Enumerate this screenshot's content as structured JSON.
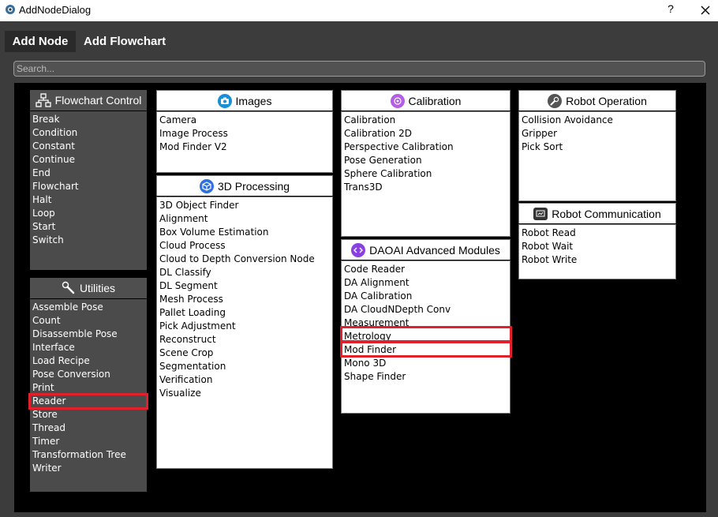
{
  "window": {
    "title": "AddNodeDialog",
    "help": "?"
  },
  "tabs": [
    {
      "label": "Add Node"
    },
    {
      "label": "Add Flowchart"
    }
  ],
  "search": {
    "placeholder": "Search..."
  },
  "colors": {
    "highlight": "#e0202a",
    "images_icon": "#1a8fd6",
    "calibration_icon": "#b45ee8",
    "processing_icon": "#2f6fe0",
    "daoai_icon": "#8a3fe0"
  },
  "panels": {
    "flowchart_control": {
      "title": "Flowchart Control",
      "icon": "flowchart-icon",
      "items": [
        "Break",
        "Condition",
        "Constant",
        "Continue",
        "End",
        "Flowchart",
        "Halt",
        "Loop",
        "Start",
        "Switch"
      ]
    },
    "utilities": {
      "title": "Utilities",
      "icon": "wrench-icon",
      "items": [
        "Assemble Pose",
        "Count",
        "Disassemble Pose",
        "Interface",
        "Load Recipe",
        "Pose Conversion",
        "Print",
        "Reader",
        "Store",
        "Thread",
        "Timer",
        "Transformation Tree",
        "Writer"
      ]
    },
    "images": {
      "title": "Images",
      "icon": "camera-icon",
      "items": [
        "Camera",
        "Image Process",
        "Mod Finder V2"
      ]
    },
    "processing_3d": {
      "title": "3D Processing",
      "icon": "cube-icon",
      "items": [
        "3D Object Finder",
        "Alignment",
        "Box Volume Estimation",
        "Cloud Process",
        "Cloud to Depth Conversion Node",
        "DL Classify",
        "DL Segment",
        "Mesh Process",
        "Pallet Loading",
        "Pick Adjustment",
        "Reconstruct",
        "Scene Crop",
        "Segmentation",
        "Verification",
        "Visualize"
      ]
    },
    "calibration": {
      "title": "Calibration",
      "icon": "target-icon",
      "items": [
        "Calibration",
        "Calibration 2D",
        "Perspective Calibration",
        "Pose Generation",
        "Sphere Calibration",
        "Trans3D"
      ]
    },
    "daoai": {
      "title": "DAOAI Advanced Modules",
      "icon": "code-icon",
      "items": [
        "Code Reader",
        "DA Alignment",
        "DA Calibration",
        "DA CloudNDepth Conv",
        "Measurement",
        "Metrology",
        "Mod Finder",
        "Mono 3D",
        "Shape Finder"
      ]
    },
    "robot_operation": {
      "title": "Robot Operation",
      "icon": "wrench-icon",
      "items": [
        "Collision Avoidance",
        "Gripper",
        "Pick Sort"
      ]
    },
    "robot_communication": {
      "title": "Robot Communication",
      "icon": "monitor-icon",
      "items": [
        "Robot Read",
        "Robot Wait",
        "Robot Write"
      ]
    }
  },
  "highlighted_items": [
    "Reader",
    "Metrology",
    "Mod Finder"
  ]
}
